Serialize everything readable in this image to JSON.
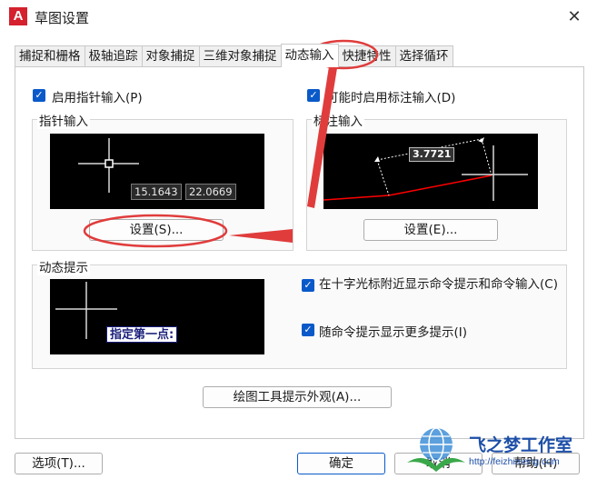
{
  "window": {
    "title": "草图设置",
    "app_icon_letter": "A",
    "close_glyph": "✕"
  },
  "tabs": [
    {
      "label": "捕捉和栅格"
    },
    {
      "label": "极轴追踪"
    },
    {
      "label": "对象捕捉"
    },
    {
      "label": "三维对象捕捉"
    },
    {
      "label": "动态输入",
      "active": true
    },
    {
      "label": "快捷特性"
    },
    {
      "label": "选择循环"
    }
  ],
  "pointer_input": {
    "enable_label": "启用指针输入(P)",
    "enable_checked": true,
    "group_title": "指针输入",
    "coord_x": "15.1643",
    "coord_y": "22.0669",
    "settings_button": "设置(S)..."
  },
  "dimension_input": {
    "enable_label": "可能时启用标注输入(D)",
    "enable_checked": true,
    "group_title": "标注输入",
    "dim_value": "3.7721",
    "settings_button": "设置(E)..."
  },
  "dynamic_prompts": {
    "group_title": "动态提示",
    "prompt_text": "指定第一点:",
    "show_near_crosshair_label": "在十字光标附近显示命令提示和命令输入(C)",
    "show_near_crosshair_checked": true,
    "show_more_label": "随命令提示显示更多提示(I)",
    "show_more_checked": true
  },
  "drafting_tooltip_button": "绘图工具提示外观(A)...",
  "footer": {
    "options_button": "选项(T)...",
    "ok_button": "确定",
    "cancel_button": "取消",
    "help_button": "帮助(H)"
  },
  "watermark": {
    "brand": "飞之梦工作室",
    "url": "http://feizhimeng.com"
  },
  "colors": {
    "accent": "#0a59c9",
    "annotation_red": "#e03c3c",
    "preview_bg": "#000000",
    "dim_line_red": "#ff0000"
  }
}
